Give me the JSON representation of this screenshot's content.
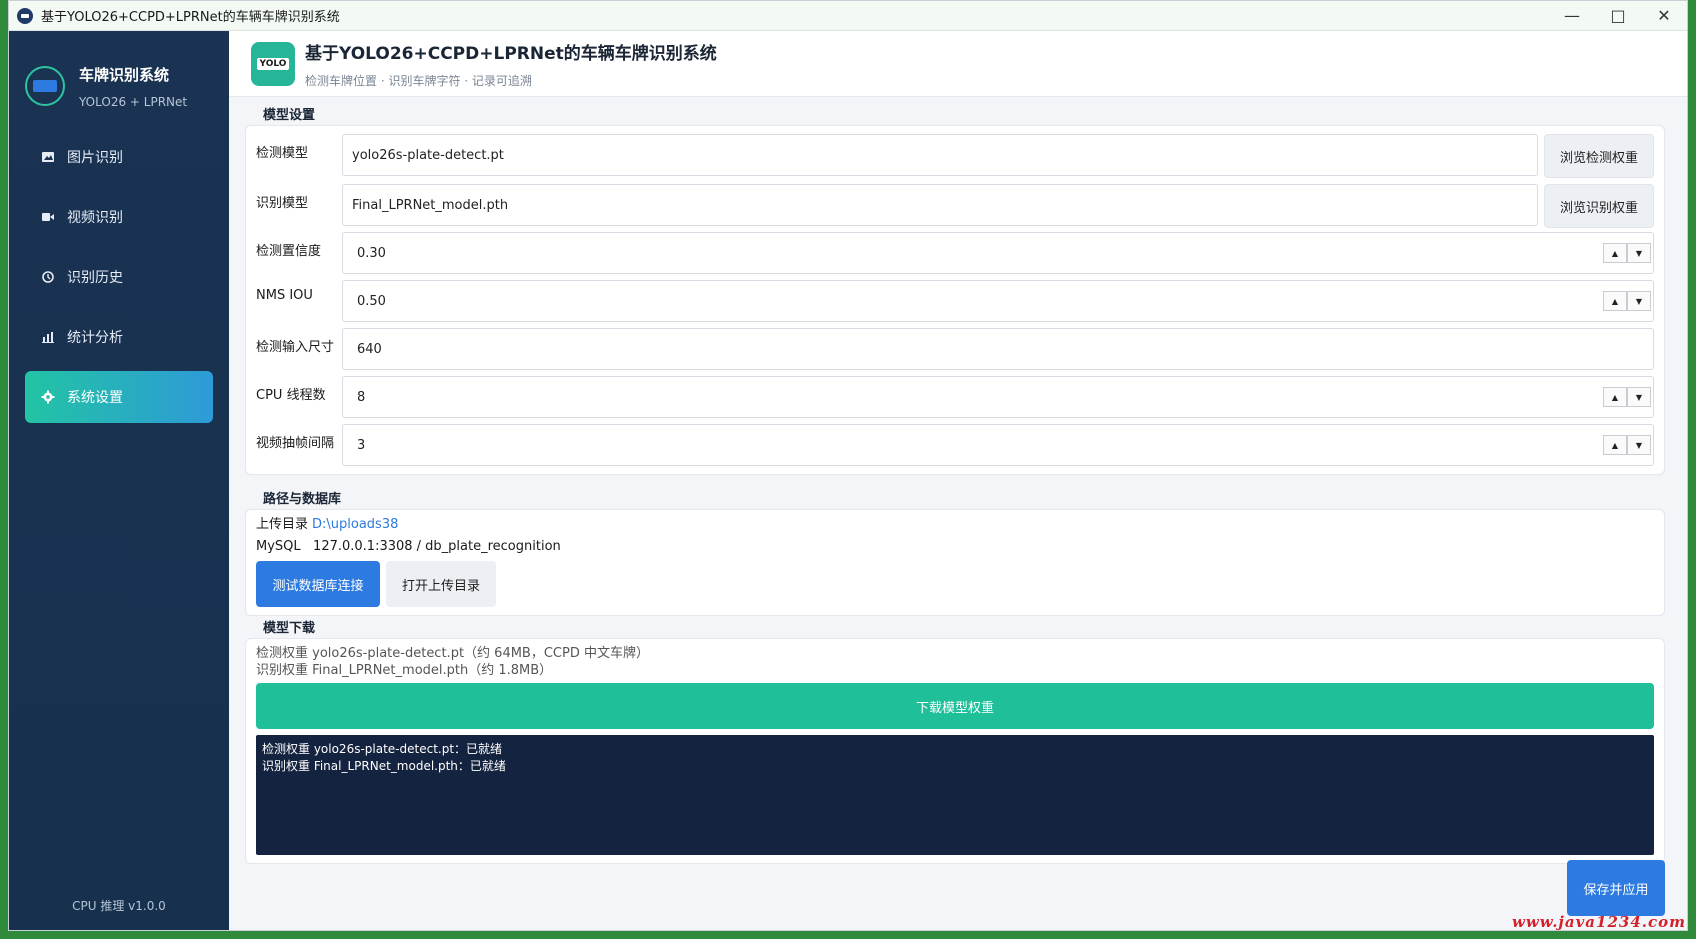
{
  "window": {
    "title": "基于YOLO26+CCPD+LPRNet的车辆车牌识别系统"
  },
  "sidebar": {
    "brand_name": "车牌识别系统",
    "brand_sub": "YOLO26 + LPRNet",
    "items": [
      {
        "label": "图片识别",
        "icon": "image-icon"
      },
      {
        "label": "视频识别",
        "icon": "video-icon"
      },
      {
        "label": "识别历史",
        "icon": "history-icon"
      },
      {
        "label": "统计分析",
        "icon": "chart-icon"
      },
      {
        "label": "系统设置",
        "icon": "gear-icon",
        "active": true
      }
    ],
    "footer": "CPU 推理  v1.0.0"
  },
  "header": {
    "logo_text": "YOLO",
    "title": "基于YOLO26+CCPD+LPRNet的车辆车牌识别系统",
    "subtitle": "检测车牌位置 · 识别车牌字符 · 记录可追溯"
  },
  "model_settings": {
    "section_title": "模型设置",
    "detect_model": {
      "label": "检测模型",
      "value": "yolo26s-plate-detect.pt",
      "button": "浏览检测权重"
    },
    "recog_model": {
      "label": "识别模型",
      "value": "Final_LPRNet_model.pth",
      "button": "浏览识别权重"
    },
    "conf": {
      "label": "检测置信度",
      "value": "0.30"
    },
    "nms": {
      "label": "NMS IOU",
      "value": "0.50"
    },
    "imgsz": {
      "label": "检测输入尺寸",
      "value": "640"
    },
    "threads": {
      "label": "CPU 线程数",
      "value": "8"
    },
    "frame_interval": {
      "label": "视频抽帧间隔",
      "value": "3"
    }
  },
  "paths": {
    "section_title": "路径与数据库",
    "upload_label": "上传目录",
    "upload_value": "D:\\uploads38",
    "mysql_label": "MySQL",
    "mysql_value": "127.0.0.1:3308 / db_plate_recognition",
    "test_db_button": "测试数据库连接",
    "open_dir_button": "打开上传目录"
  },
  "download": {
    "section_title": "模型下载",
    "line1": "检测权重 yolo26s-plate-detect.pt（约 64MB，CCPD 中文车牌）",
    "line2": "识别权重 Final_LPRNet_model.pth（约 1.8MB）",
    "button": "下载模型权重",
    "log1": "检测权重 yolo26s-plate-detect.pt：已就绪",
    "log2": "识别权重 Final_LPRNet_model.pth：已就绪"
  },
  "save_button": "保存并应用",
  "watermark": "www.java1234.com"
}
